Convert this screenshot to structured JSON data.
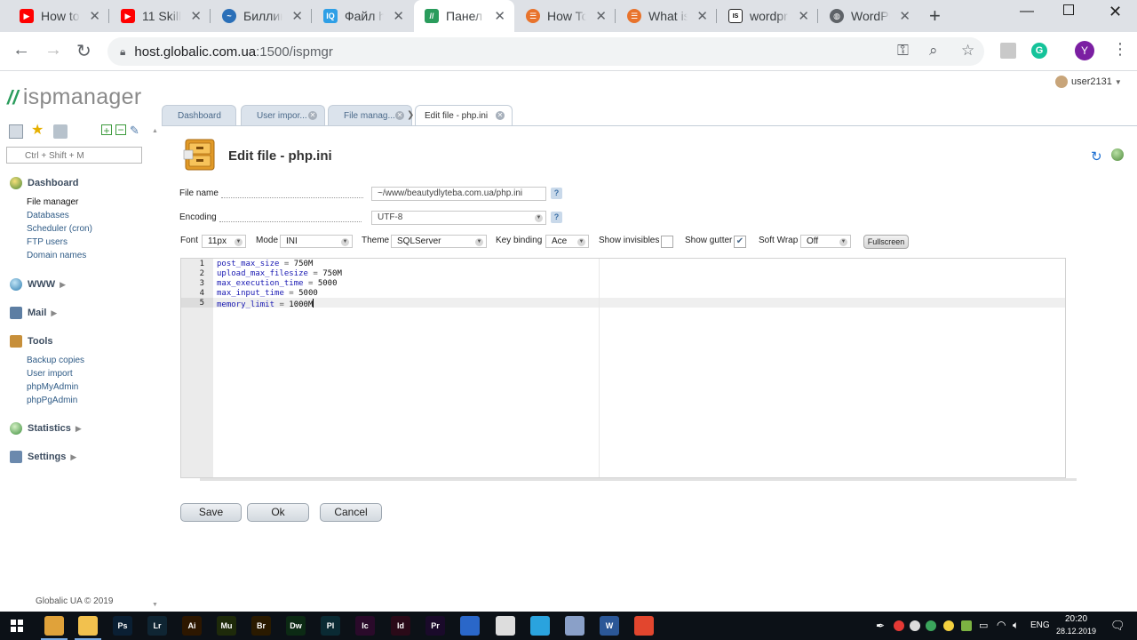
{
  "browser": {
    "tabs": [
      {
        "title": "How to",
        "favicon": "youtube-icon",
        "color": "#ff0000"
      },
      {
        "title": "11 Skill",
        "favicon": "youtube-icon",
        "color": "#ff0000"
      },
      {
        "title": "Биллин",
        "favicon": "billing-icon",
        "color": "#2a6fb8"
      },
      {
        "title": "Файл h",
        "favicon": "iq-icon",
        "color": "#2e9fe6"
      },
      {
        "title": "Панел",
        "favicon": "ispmanager-icon",
        "color": "#2a9c5c"
      },
      {
        "title": "How To",
        "favicon": "stackexchange-icon",
        "color": "#e8732c"
      },
      {
        "title": "What is",
        "favicon": "stackexchange-icon",
        "color": "#e8732c"
      },
      {
        "title": "wordpr",
        "favicon": "issue-icon",
        "color": "#222222"
      },
      {
        "title": "WordPr",
        "favicon": "globe-icon",
        "color": "#5f6368"
      }
    ],
    "active_tab": 4,
    "url_host": "host.globalic.com.ua",
    "url_path": ":1500/ispmgr",
    "profile_initial": "Y"
  },
  "app": {
    "logo_text": "ispmanager",
    "user": "user2131",
    "search_placeholder": "Ctrl + Shift + M",
    "footer": "Globalic UA © 2019"
  },
  "sidebar": {
    "sections": [
      {
        "label": "Dashboard",
        "icon": "dashboard-icon",
        "items": [
          "File manager",
          "Databases",
          "Scheduler (cron)",
          "FTP users",
          "Domain names"
        ]
      },
      {
        "label": "WWW",
        "icon": "www-icon",
        "items": []
      },
      {
        "label": "Mail",
        "icon": "mail-icon",
        "items": []
      },
      {
        "label": "Tools",
        "icon": "tools-icon",
        "items": [
          "Backup copies",
          "User import",
          "phpMyAdmin",
          "phpPgAdmin"
        ]
      },
      {
        "label": "Statistics",
        "icon": "statistics-icon",
        "items": []
      },
      {
        "label": "Settings",
        "icon": "settings-icon",
        "items": []
      }
    ],
    "current_item": "File manager"
  },
  "page_tabs": [
    {
      "label": "Dashboard",
      "closable": false
    },
    {
      "label": "User impor...",
      "closable": true
    },
    {
      "label": "File manag...",
      "closable": true
    },
    {
      "label": "Edit file - php.ini",
      "closable": true
    }
  ],
  "form": {
    "title": "Edit file - php.ini",
    "file_name_label": "File name",
    "file_name_value": "~/www/beautydlyteba.com.ua/php.ini",
    "encoding_label": "Encoding",
    "encoding_value": "UTF-8",
    "help_mark": "?"
  },
  "editor_options": {
    "font_label": "Font",
    "font_value": "11px",
    "mode_label": "Mode",
    "mode_value": "INI",
    "theme_label": "Theme",
    "theme_value": "SQLServer",
    "keybinding_label": "Key binding",
    "keybinding_value": "Ace",
    "show_invisibles_label": "Show invisibles",
    "show_invisibles": false,
    "show_gutter_label": "Show gutter",
    "show_gutter": true,
    "soft_wrap_label": "Soft Wrap",
    "soft_wrap_value": "Off",
    "fullscreen_label": "Fullscreen"
  },
  "editor": {
    "lines": [
      {
        "n": "1",
        "key": "post_max_size",
        "op": " = ",
        "val": "750M"
      },
      {
        "n": "2",
        "key": "upload_max_filesize",
        "op": " = ",
        "val": "750M"
      },
      {
        "n": "3",
        "key": "max_execution_time",
        "op": " = ",
        "val": "5000"
      },
      {
        "n": "4",
        "key": "max_input_time",
        "op": " = ",
        "val": "5000"
      },
      {
        "n": "5",
        "key": "memory_limit",
        "op": " = ",
        "val": "1000M"
      }
    ],
    "active_line": 5
  },
  "buttons": {
    "save": "Save",
    "ok": "Ok",
    "cancel": "Cancel"
  },
  "taskbar": {
    "apps": [
      {
        "label": "",
        "icon": "chrome-icon",
        "color": "#e0a23a"
      },
      {
        "label": "",
        "icon": "folder-icon",
        "color": "#f2c14e"
      },
      {
        "label": "Ps",
        "icon": "photoshop-icon",
        "color": "#0a1f33"
      },
      {
        "label": "Lr",
        "icon": "lightroom-icon",
        "color": "#0f2533"
      },
      {
        "label": "Ai",
        "icon": "illustrator-icon",
        "color": "#2d1700"
      },
      {
        "label": "Mu",
        "icon": "muse-icon",
        "color": "#1e2a0a"
      },
      {
        "label": "Br",
        "icon": "bridge-icon",
        "color": "#2a1a00"
      },
      {
        "label": "Dw",
        "icon": "dreamweaver-icon",
        "color": "#0c2a14"
      },
      {
        "label": "Pl",
        "icon": "prelude-icon",
        "color": "#0a2a33"
      },
      {
        "label": "Ic",
        "icon": "incopy-icon",
        "color": "#2a0a2a"
      },
      {
        "label": "Id",
        "icon": "indesign-icon",
        "color": "#2a0a18"
      },
      {
        "label": "Pr",
        "icon": "premiere-icon",
        "color": "#1a0a2a"
      },
      {
        "label": "",
        "icon": "app-icon",
        "color": "#2a67c9"
      },
      {
        "label": "",
        "icon": "inkscape-icon",
        "color": "#dddddd"
      },
      {
        "label": "",
        "icon": "telegram-icon",
        "color": "#2aa3de"
      },
      {
        "label": "",
        "icon": "screenshot-icon",
        "color": "#8aa0c8"
      },
      {
        "label": "W",
        "icon": "word-icon",
        "color": "#2b5797"
      },
      {
        "label": "",
        "icon": "xmind-icon",
        "color": "#e2462e"
      }
    ],
    "lang": "ENG",
    "time": "20:20",
    "date": "28.12.2019"
  },
  "colors": {
    "accent": "#2a9c5c",
    "link": "#2f5b86",
    "tab_bg": "#dbe3ec"
  }
}
